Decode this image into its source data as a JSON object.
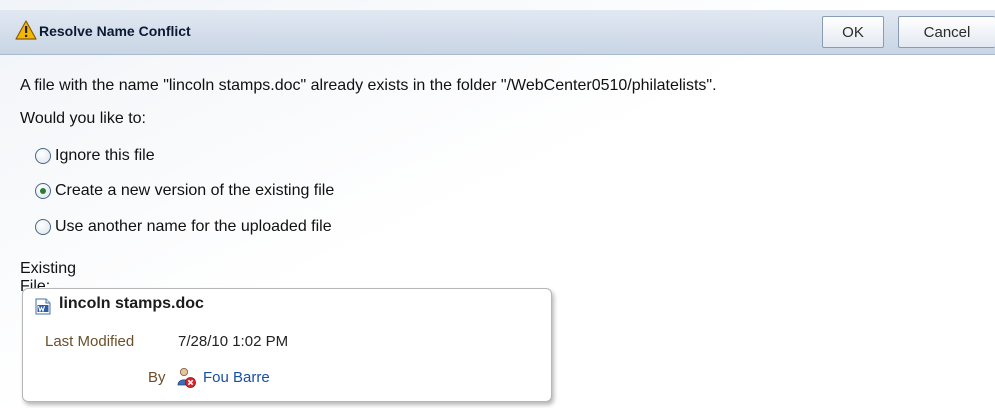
{
  "dialog": {
    "title": "Resolve Name Conflict",
    "ok_label": "OK",
    "cancel_label": "Cancel",
    "title_icon": "warning-icon"
  },
  "message": "A file with the name \"lincoln stamps.doc\" already exists in the folder \"/WebCenter0510/philatelists\".",
  "prompt": "Would you like to:",
  "options": [
    {
      "label": "Ignore this file",
      "selected": false
    },
    {
      "label": "Create a new version of the existing file",
      "selected": true
    },
    {
      "label": "Use another name for the uploaded file",
      "selected": false
    }
  ],
  "existing_file": {
    "section_label": "Existing File:",
    "file_icon": "word-document-icon",
    "name": "lincoln stamps.doc",
    "last_modified_label": "Last Modified",
    "last_modified_value": "7/28/10 1:02 PM",
    "by_label": "By",
    "user_icon": "user-offline-icon",
    "user": "Fou Barre"
  },
  "colors": {
    "header_bg": "#c9d5e4",
    "link": "#1a4fa3",
    "label_brown": "#6b4f2a",
    "radio_selected": "#2a7d2e"
  }
}
